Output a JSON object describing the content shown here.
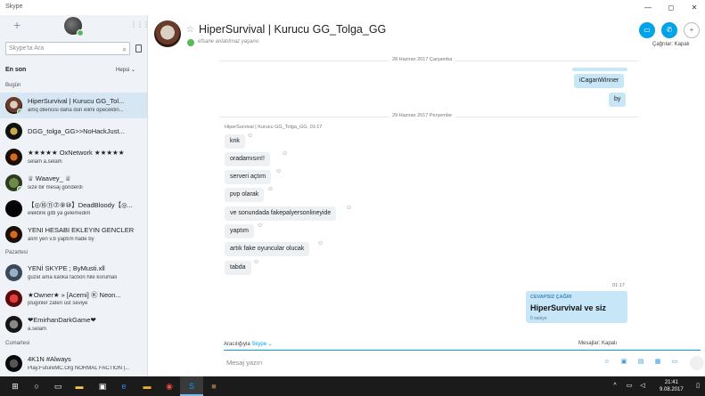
{
  "window": {
    "title": "Skype",
    "controls": [
      "—",
      "◻",
      "✕"
    ]
  },
  "sidebar": {
    "search_placeholder": "Skype'ta Ara",
    "list_heading": "En son",
    "filter": "Hepsi ⌄",
    "sections": {
      "today": "Bugün",
      "monday": "Pazartesi",
      "saturday": "Cumartesi"
    },
    "chats": [
      {
        "name": "HiperSurvival | Kurucu GG_Tol...",
        "preview": "amq dilencisi daha dün elimi öpecektin...",
        "active": true,
        "online": true
      },
      {
        "name": "DGG_tolga_GG>>NoHackJust...",
        "preview": "",
        "active": false,
        "online": false
      },
      {
        "name": "★★★★★ OxNetwork ★★★★★",
        "preview": "selam a.selam",
        "active": false,
        "online": false
      },
      {
        "name": "♕ Waavey_ ♕",
        "preview": "size bir mesaj gönderdi",
        "active": false,
        "online": true
      },
      {
        "name": "【◎⑯⑪⑦⑨⑩】DeadBloody【◎...",
        "preview": "elektirik gitti ya gelemedim",
        "active": false,
        "online": false
      },
      {
        "name": "YENI HESABI EKLEYIN GENCLER",
        "preview": "alım yeri v.b yaptım hade by",
        "active": false,
        "online": false
      },
      {
        "name": "YENİ SKYPE ; ByMusti.xll",
        "preview": "güzel ama kanka faction hile korumalı",
        "active": false,
        "online": false
      },
      {
        "name": "★Owner★ » [Acemi] Ⓚ Neon...",
        "preview": "pluginler zaten üst seviye",
        "active": false,
        "online": false
      },
      {
        "name": "❤EmirhanDarkGame❤",
        "preview": "a.selam",
        "active": false,
        "online": false
      },
      {
        "name": "4K1N #Always",
        "preview": "Play.FutureMC.Org NORMAL FACTION |...",
        "active": false,
        "online": false
      }
    ]
  },
  "chat": {
    "title": "HiperSurvival | Kurucu GG_Tolga_GG",
    "status": "efsane anlatılmaz yaşanır.",
    "calls_label": "Çağrılar: Kapalı",
    "date_1": "28 Haziran 2017 Çarşamba",
    "date_2": "29 Haziran 2017 Perşembe",
    "outgoing": [
      "iCaganWinner",
      "by"
    ],
    "sender_line": "HiperSurvival | Kurucu GG_Tolga_GG, 01:17",
    "incoming": [
      "knk",
      "oradamısın!!",
      "serveri açtım",
      "pvp olarak",
      "ve sonundada fakepalyersonlineyide",
      "yaptım",
      "artık fake oyuncular olucak",
      "tabda"
    ],
    "missed_time": "01:17",
    "missed_label": "CEVAPSIZ ÇAĞRI",
    "missed_title": "HiperSurvival ve siz",
    "missed_seen": "0 saniye"
  },
  "compose": {
    "via_prefix": "Aracılığıyla",
    "via_service": "Skype ⌄",
    "messages_label": "Mesajlar: Kapalı",
    "placeholder": "Mesaj yazın"
  },
  "taskbar": {
    "time": "21:41",
    "date": "9.08.2017"
  },
  "colors": {
    "accent": "#00a2e8",
    "online": "#5cb85c",
    "outgoing_bubble": "#c7e6f7",
    "incoming_bubble": "#eef1f4",
    "sidebar_bg": "#eff3f7"
  }
}
